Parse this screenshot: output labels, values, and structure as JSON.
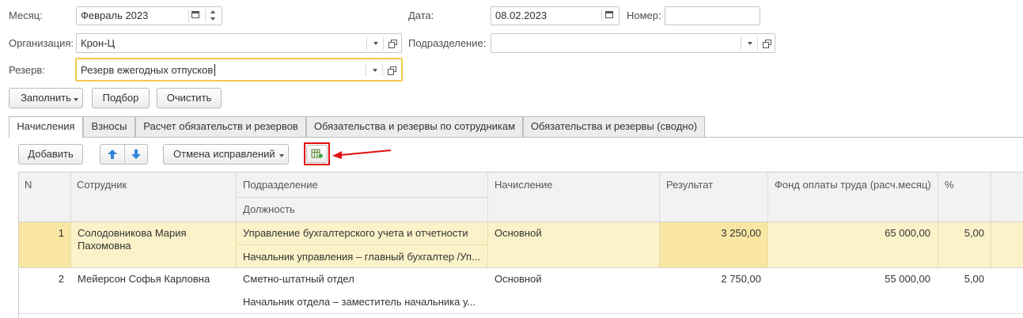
{
  "header": {
    "month_label": "Месяц:",
    "month_value": "Февраль 2023",
    "date_label": "Дата:",
    "date_value": "08.02.2023",
    "number_label": "Номер:",
    "number_value": "",
    "org_label": "Организация:",
    "org_value": "Крон-Ц",
    "dept_label": "Подразделение:",
    "dept_value": "",
    "reserve_label": "Резерв:",
    "reserve_value": "Резерв ежегодных отпусков"
  },
  "toolbar": {
    "fill_label": "Заполнить",
    "pick_label": "Подбор",
    "clear_label": "Очистить"
  },
  "tabs": [
    {
      "label": "Начисления",
      "active": true
    },
    {
      "label": "Взносы"
    },
    {
      "label": "Расчет обязательств и резервов"
    },
    {
      "label": "Обязательства и резервы по сотрудникам"
    },
    {
      "label": "Обязательства и резервы (сводно)"
    }
  ],
  "table_toolbar": {
    "add_label": "Добавить",
    "cancel_fix_label": "Отмена исправлений"
  },
  "table": {
    "columns": {
      "n": "N",
      "employee": "Сотрудник",
      "department": "Подразделение",
      "position": "Должность",
      "accrual": "Начисление",
      "result": "Результат",
      "fund": "Фонд оплаты труда (расч.месяц)",
      "percent": "%"
    },
    "rows": [
      {
        "n": "1",
        "employee": "Солодовникова Мария Пахомовна",
        "department": "Управление бухгалтерского учета и отчетности",
        "position": "Начальник управления – главный бухгалтер /Уп...",
        "accrual": "Основной",
        "result": "3 250,00",
        "fund": "65 000,00",
        "percent": "5,00"
      },
      {
        "n": "2",
        "employee": "Мейерсон Софья Карловна",
        "department": "Сметно-штатный отдел",
        "position": "Начальник отдела – заместитель начальника у...",
        "accrual": "Основной",
        "result": "2 750,00",
        "fund": "55 000,00",
        "percent": "5,00"
      }
    ]
  },
  "colors": {
    "accent_yellow": "#f2c94c",
    "selected_row": "#fbf2c9",
    "highlight_red": "#e01010"
  }
}
